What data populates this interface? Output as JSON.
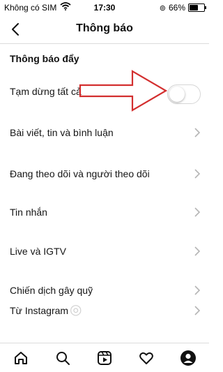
{
  "status_bar": {
    "carrier": "Không có SIM",
    "time": "17:30",
    "battery_text": "66%",
    "battery_level": 0.66
  },
  "header": {
    "title": "Thông báo",
    "back_icon": "chevron-left-icon"
  },
  "section": {
    "title": "Thông báo đẩy"
  },
  "pause_all": {
    "label": "Tạm dừng tất cả",
    "enabled": false
  },
  "items": [
    {
      "label": "Bài viết, tin và bình luận"
    },
    {
      "label": "Đang theo dõi và người theo dõi"
    },
    {
      "label": "Tin nhắn"
    },
    {
      "label": "Live và IGTV"
    },
    {
      "label": "Chiến dịch gây quỹ"
    },
    {
      "label": "Từ Instagram"
    }
  ],
  "annotation": {
    "color": "#d32f2f"
  },
  "bottom_nav": [
    "home-icon",
    "search-icon",
    "reels-icon",
    "heart-icon",
    "profile-icon"
  ]
}
